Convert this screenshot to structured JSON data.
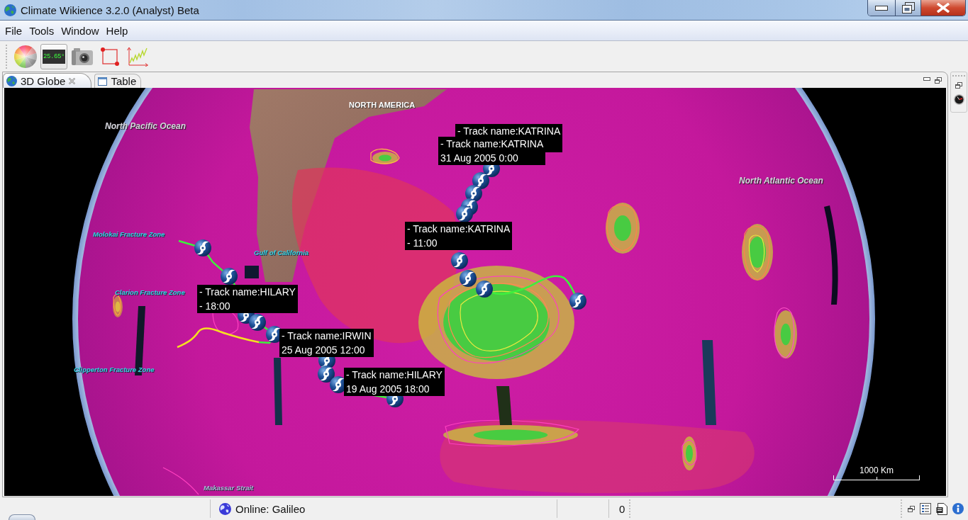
{
  "window": {
    "title": "Climate Wikience 3.2.0 (Analyst) Beta"
  },
  "menu": [
    {
      "label": "File"
    },
    {
      "label": "Tools"
    },
    {
      "label": "Window"
    },
    {
      "label": "Help"
    }
  ],
  "toolbar": [
    {
      "kind": "tool",
      "pressed": false
    },
    {
      "kind": "readout",
      "text": "25.65°",
      "pressed": true
    },
    {
      "kind": "tool",
      "pressed": false
    },
    {
      "kind": "tool",
      "pressed": false
    },
    {
      "kind": "tool",
      "pressed": false
    }
  ],
  "tabs": [
    {
      "label": "3D Globe",
      "selected": true,
      "closable": true
    },
    {
      "label": "Table",
      "selected": false,
      "closable": false
    }
  ],
  "globe": {
    "place_labels": [
      {
        "kind": "ocean",
        "text": "North Pacific Ocean"
      },
      {
        "kind": "continent",
        "text": "NORTH AMERICA"
      },
      {
        "kind": "ocean",
        "text": "North Atlantic Ocean"
      },
      {
        "kind": "feature",
        "text": "Molokai Fracture Zone"
      },
      {
        "kind": "feature",
        "text": "Gulf of California"
      },
      {
        "kind": "feature",
        "text": "Clarion Fracture Zone"
      },
      {
        "kind": "feature",
        "text": "Clipperton Fracture Zone"
      },
      {
        "kind": "strait",
        "text": "Makassar Strait"
      }
    ],
    "track_labels": [
      {
        "lines": [
          "- Track name:KATRINA"
        ]
      },
      {
        "lines": [
          "- Track name:KATRINA",
          "31 Aug 2005 0:00"
        ]
      },
      {
        "lines": [
          "- Track name:KATRINA",
          "- 11:00"
        ]
      },
      {
        "lines": [
          "- Track name:HILARY",
          "- 18:00"
        ]
      },
      {
        "lines": [
          "- Track name:IRWIN",
          "25 Aug 2005 12:00"
        ]
      },
      {
        "lines": [
          "- Track name:HILARY",
          "19 Aug 2005 18:00"
        ]
      }
    ],
    "scale": "1000 Km"
  },
  "status_bar": {
    "connection": "Online: Galileo",
    "count": "0"
  }
}
